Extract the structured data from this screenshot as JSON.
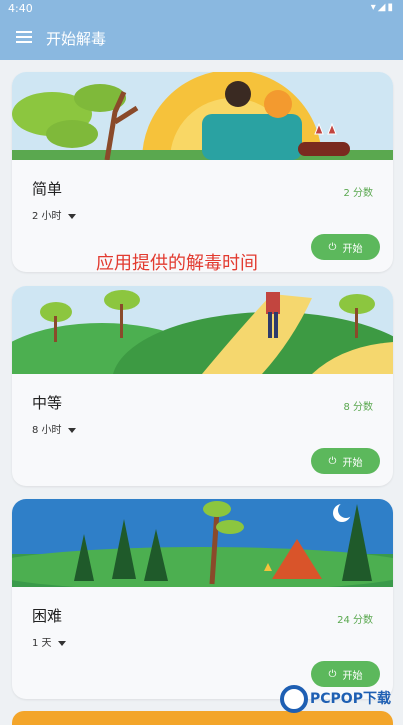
{
  "status": {
    "time": "4:40"
  },
  "appbar": {
    "title": "开始解毒"
  },
  "cards": [
    {
      "name": "简单",
      "score": "2 分数",
      "duration": "2 小时",
      "start": "开始"
    },
    {
      "name": "中等",
      "score": "8 分数",
      "duration": "8 小时",
      "start": "开始"
    },
    {
      "name": "困难",
      "score": "24 分数",
      "duration": "1 天",
      "start": "开始"
    }
  ],
  "annotation": "应用提供的解毒时间",
  "watermark": "PCPOP下载",
  "colors": {
    "accent": "#8ab8e0",
    "start_button": "#5cb85c",
    "score": "#5aa84f",
    "annotation": "#e23b30"
  },
  "icons": {
    "menu": "menu-icon",
    "start": "power-icon",
    "dropdown": "caret-down-icon"
  }
}
